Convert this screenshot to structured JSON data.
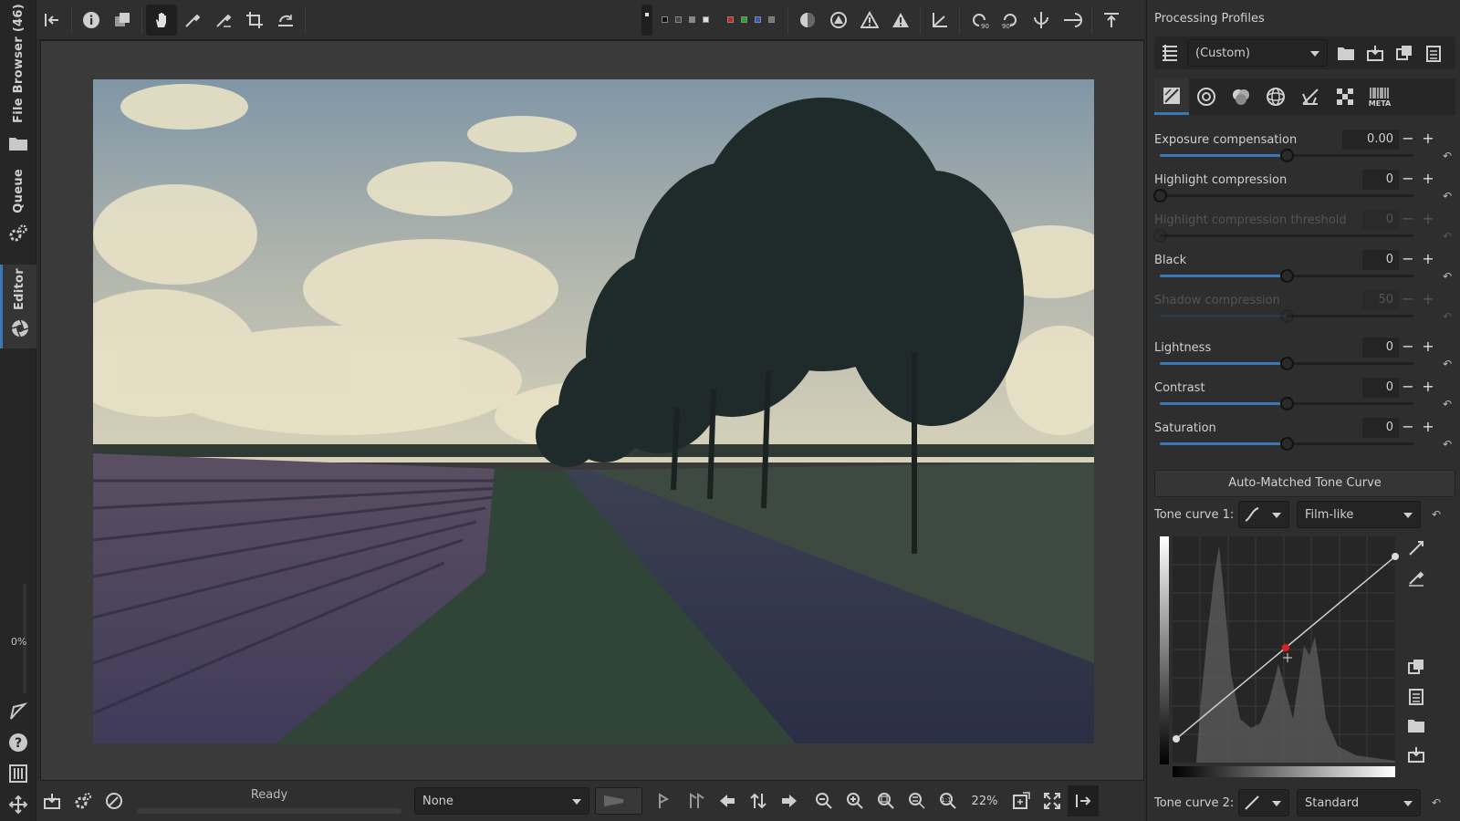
{
  "left_tabs": {
    "file_browser": "File Browser (46)",
    "queue": "Queue",
    "editor": "Editor",
    "zoom_percent": "0%"
  },
  "top_toolbar": {
    "swatch_colors_gray": [
      "#111111",
      "#444444",
      "#888888",
      "#dddddd"
    ],
    "swatch_colors_rgb": [
      "#cc2222",
      "#22aa22",
      "#3355cc",
      "#777777"
    ]
  },
  "bottom_toolbar": {
    "status": "Ready",
    "color_mode": "None",
    "zoom": "22%"
  },
  "right_panel": {
    "title": "Processing Profiles",
    "profile": "(Custom)",
    "tabs": [
      "exposure",
      "detail",
      "color",
      "advanced",
      "transform",
      "raw",
      "meta"
    ],
    "meta_label": "META",
    "sliders": [
      {
        "label": "Exposure compensation",
        "value": "0.00",
        "position": 0.5,
        "enabled": true
      },
      {
        "label": "Highlight compression",
        "value": "0",
        "position": 0.0,
        "enabled": true
      },
      {
        "label": "Highlight compression threshold",
        "value": "0",
        "position": 0.0,
        "enabled": false
      },
      {
        "label": "Black",
        "value": "0",
        "position": 0.5,
        "enabled": true
      },
      {
        "label": "Shadow compression",
        "value": "50",
        "position": 0.5,
        "enabled": false
      },
      {
        "label": "Lightness",
        "value": "0",
        "position": 0.5,
        "enabled": true
      },
      {
        "label": "Contrast",
        "value": "0",
        "position": 0.5,
        "enabled": true
      },
      {
        "label": "Saturation",
        "value": "0",
        "position": 0.5,
        "enabled": true
      }
    ],
    "auto_matched": "Auto-Matched Tone Curve",
    "tone_curve_1_label": "Tone curve 1:",
    "tone_curve_1_mode": "Film-like",
    "tone_curve_2_label": "Tone curve 2:",
    "tone_curve_2_mode": "Standard",
    "accent_color": "#3b78b5"
  }
}
